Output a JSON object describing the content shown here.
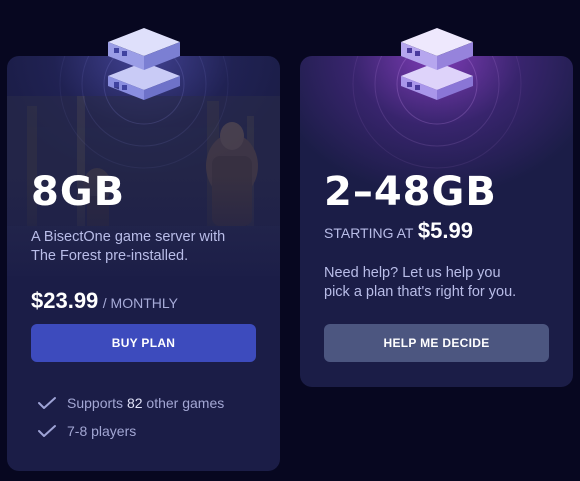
{
  "colors": {
    "page_bg": "#070720",
    "card_bg": "#1b1d47",
    "buy_button": "#3d4bbd",
    "help_button": "#4c5680",
    "accent_glow_left": "#6260d2",
    "accent_glow_right": "#a046dc"
  },
  "left_card": {
    "icon": "server-stack-icon",
    "title": "8GB",
    "description_line1": "A BisectOne game server with",
    "description_line2": "The Forest pre-installed.",
    "price": "$23.99",
    "period": "/ MONTHLY",
    "button_label": "BUY PLAN",
    "features": {
      "f1_prefix": "Supports ",
      "f1_highlight": "82",
      "f1_suffix": " other games",
      "f2": "7-8 players"
    }
  },
  "right_card": {
    "icon": "server-stack-icon",
    "title": "2–48GB",
    "starting_label": "STARTING AT",
    "starting_price": "$5.99",
    "help_line1": "Need help? Let us help you",
    "help_line2": "pick a plan that's right for you.",
    "button_label": "HELP ME DECIDE"
  }
}
